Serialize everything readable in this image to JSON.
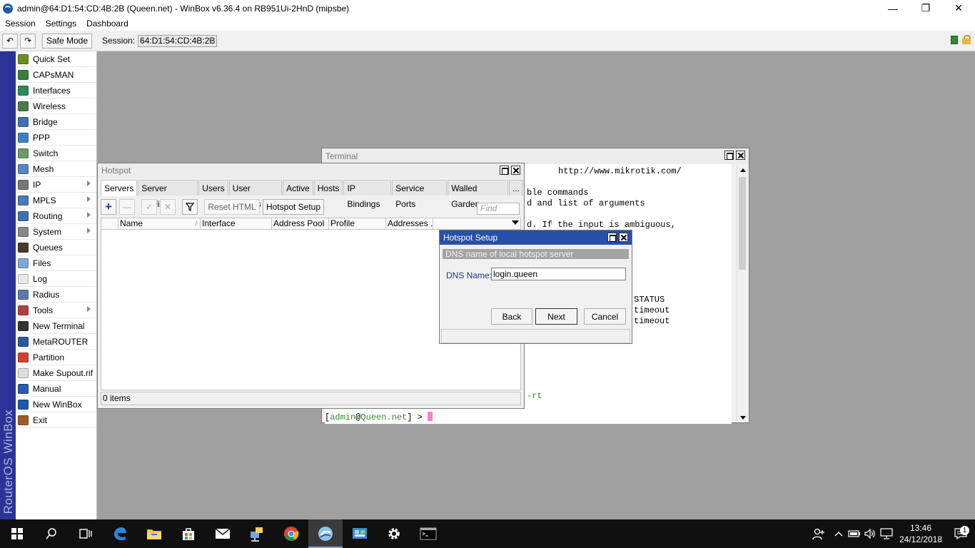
{
  "window": {
    "title": "admin@64:D1:54:CD:4B:2B (Queen.net) - WinBox v6.36.4 on RB951Ui-2HnD (mipsbe)",
    "minimize": "—",
    "restore": "❐",
    "close": "✕"
  },
  "menu": [
    "Session",
    "Settings",
    "Dashboard"
  ],
  "toolbar": {
    "undo": "↶",
    "redo": "↷",
    "safe_mode": "Safe Mode",
    "session_label": "Session:",
    "session_value": "64:D1:54:CD:4B:2B"
  },
  "brand": "RouterOS WinBox",
  "sidebar": {
    "items": [
      {
        "label": "Quick Set",
        "icon": "quickset-icon",
        "color": "#6b8e23",
        "submenu": false
      },
      {
        "label": "CAPsMAN",
        "icon": "antenna-icon",
        "color": "#3a7d3a",
        "submenu": false
      },
      {
        "label": "Interfaces",
        "icon": "interfaces-icon",
        "color": "#2e8b57",
        "submenu": false
      },
      {
        "label": "Wireless",
        "icon": "wireless-icon",
        "color": "#4a7a4a",
        "submenu": false
      },
      {
        "label": "Bridge",
        "icon": "bridge-icon",
        "color": "#3f6fb5",
        "submenu": false
      },
      {
        "label": "PPP",
        "icon": "ppp-icon",
        "color": "#3f7fc0",
        "submenu": false
      },
      {
        "label": "Switch",
        "icon": "switch-icon",
        "color": "#6a9a6a",
        "submenu": false
      },
      {
        "label": "Mesh",
        "icon": "mesh-icon",
        "color": "#5a86c0",
        "submenu": false
      },
      {
        "label": "IP",
        "icon": "ip-icon",
        "color": "#777777",
        "submenu": true
      },
      {
        "label": "MPLS",
        "icon": "mpls-icon",
        "color": "#4a7ab5",
        "submenu": true
      },
      {
        "label": "Routing",
        "icon": "routing-icon",
        "color": "#3f6fb5",
        "submenu": true
      },
      {
        "label": "System",
        "icon": "gear-icon",
        "color": "#888888",
        "submenu": true
      },
      {
        "label": "Queues",
        "icon": "queues-icon",
        "color": "#4a3a2a",
        "submenu": false
      },
      {
        "label": "Files",
        "icon": "folder-icon",
        "color": "#7fa7d0",
        "submenu": false
      },
      {
        "label": "Log",
        "icon": "log-icon",
        "color": "#e8e8e8",
        "submenu": false
      },
      {
        "label": "Radius",
        "icon": "radius-icon",
        "color": "#5a7ab0",
        "submenu": false
      },
      {
        "label": "Tools",
        "icon": "tools-icon",
        "color": "#b04040",
        "submenu": true
      },
      {
        "label": "New Terminal",
        "icon": "terminal-icon",
        "color": "#333333",
        "submenu": false
      },
      {
        "label": "MetaROUTER",
        "icon": "metarouter-icon",
        "color": "#2a5a9a",
        "submenu": false
      },
      {
        "label": "Partition",
        "icon": "partition-icon",
        "color": "#d04030",
        "submenu": false
      },
      {
        "label": "Make Supout.rif",
        "icon": "document-icon",
        "color": "#dddddd",
        "submenu": false
      },
      {
        "label": "Manual",
        "icon": "help-icon",
        "color": "#2a5ab0",
        "submenu": false
      },
      {
        "label": "New WinBox",
        "icon": "winbox-icon",
        "color": "#1e5aa8",
        "submenu": false
      },
      {
        "label": "Exit",
        "icon": "exit-icon",
        "color": "#a05a2a",
        "submenu": false
      }
    ]
  },
  "terminal": {
    "title": "Terminal",
    "lines": [
      {
        "text": "http://www.mikrotik.com/",
        "color": "#000000"
      },
      {
        "text": "ble commands",
        "color": "#000000"
      },
      {
        "text": "d and list of arguments",
        "color": "#000000"
      },
      {
        "text": "d. If the input is ambiguous,",
        "color": "#000000"
      },
      {
        "text": "STATUS",
        "color": "#000000"
      },
      {
        "text": "timeout",
        "color": "#000000"
      },
      {
        "text": "timeout",
        "color": "#000000"
      },
      {
        "text": "-rt",
        "color": "#2e8b2e"
      }
    ],
    "prompt_open": "[",
    "prompt_user": "admin",
    "prompt_at": "@",
    "prompt_host": "Queen.net",
    "prompt_close": "] >",
    "cursor_color": "#ff80c0"
  },
  "hotspot": {
    "title": "Hotspot",
    "tabs": [
      "Servers",
      "Server Profiles",
      "Users",
      "User Profiles",
      "Active",
      "Hosts",
      "IP Bindings",
      "Service Ports",
      "Walled Garden",
      "..."
    ],
    "active_tab": 0,
    "buttons": {
      "add": "+",
      "remove": "—",
      "enable": "✓",
      "disable": "✕",
      "reset_html": "Reset HTML",
      "hotspot_setup": "Hotspot Setup"
    },
    "find_placeholder": "Find",
    "columns": [
      "",
      "Name",
      "Interface",
      "Address Pool",
      "Profile",
      "Addresses ..."
    ],
    "sort_mark": "/",
    "status": "0 items"
  },
  "setup": {
    "title": "Hotspot Setup",
    "section": "DNS name of local hotspot server",
    "dns_label": "DNS Name:",
    "dns_value": "login.queen",
    "back": "Back",
    "next": "Next",
    "cancel": "Cancel"
  },
  "taskbar": {
    "time": "13:46",
    "date": "24/12/2018",
    "notification_count": "1"
  }
}
